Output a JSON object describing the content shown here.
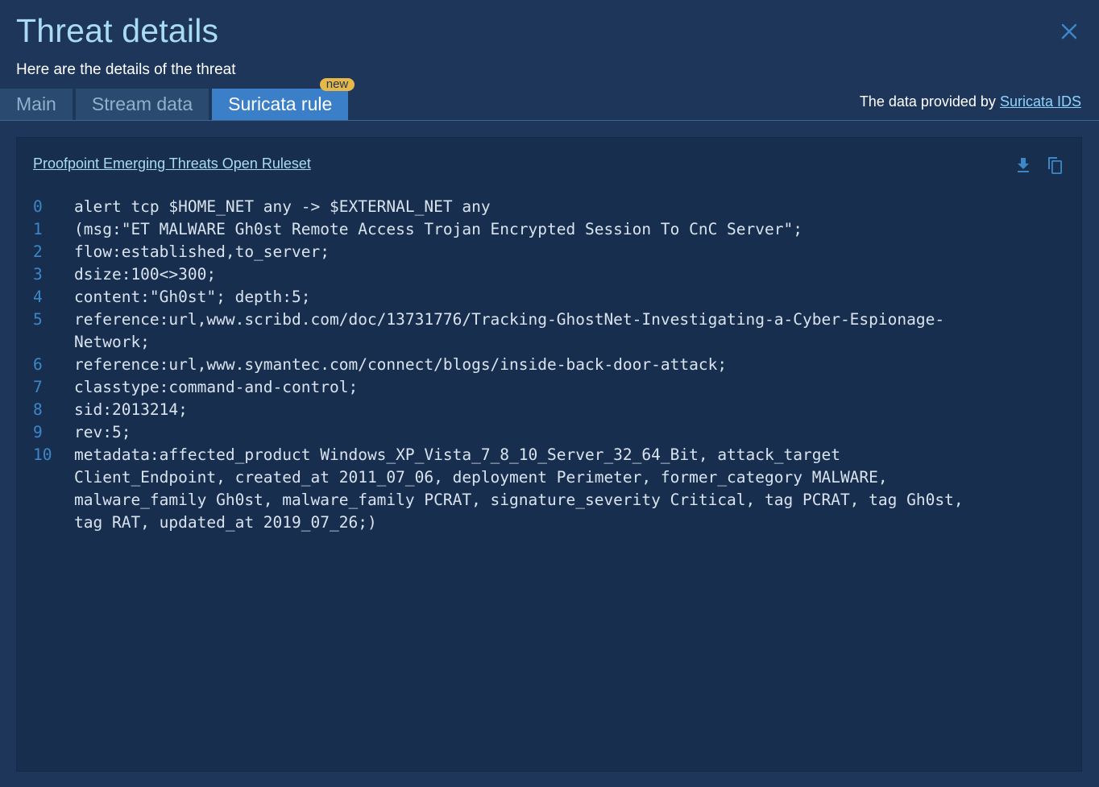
{
  "dialog": {
    "title": "Threat details",
    "subtitle": "Here are the details of the threat",
    "close_icon": "close-icon"
  },
  "tabs": [
    {
      "label": "Main",
      "active": false
    },
    {
      "label": "Stream data",
      "active": false
    },
    {
      "label": "Suricata rule",
      "active": true,
      "badge": "new"
    }
  ],
  "provider": {
    "prefix": "The data provided by",
    "link": "Suricata IDS"
  },
  "panel": {
    "ruleset_link": "Proofpoint Emerging Threats Open Ruleset",
    "tools": [
      "download-icon",
      "copy-icon"
    ],
    "lines": [
      {
        "num": "0",
        "text": "alert tcp $HOME_NET any -> $EXTERNAL_NET any"
      },
      {
        "num": "1",
        "text": "(msg:\"ET MALWARE Gh0st Remote Access Trojan Encrypted Session To CnC Server\";"
      },
      {
        "num": "2",
        "text": "flow:established,to_server;"
      },
      {
        "num": "3",
        "text": "dsize:100<>300;"
      },
      {
        "num": "4",
        "text": "content:\"Gh0st\"; depth:5;"
      },
      {
        "num": "5",
        "text": "reference:url,www.scribd.com/doc/13731776/Tracking-GhostNet-Investigating-a-Cyber-Espionage-\nNetwork;"
      },
      {
        "num": "6",
        "text": "reference:url,www.symantec.com/connect/blogs/inside-back-door-attack;"
      },
      {
        "num": "7",
        "text": "classtype:command-and-control;"
      },
      {
        "num": "8",
        "text": "sid:2013214;"
      },
      {
        "num": "9",
        "text": "rev:5;"
      },
      {
        "num": "10",
        "text": "metadata:affected_product Windows_XP_Vista_7_8_10_Server_32_64_Bit, attack_target\nClient_Endpoint, created_at 2011_07_06, deployment Perimeter, former_category MALWARE,\nmalware_family Gh0st, malware_family PCRAT, signature_severity Critical, tag PCRAT, tag Gh0st,\ntag RAT, updated_at 2019_07_26;)"
      }
    ]
  },
  "colors": {
    "background": "#1d3659",
    "panel": "#182e4f",
    "active_tab": "#3a7fc7",
    "badge": "#e6b84a",
    "title": "#a9dcf2",
    "line_number": "#3d87c7"
  }
}
